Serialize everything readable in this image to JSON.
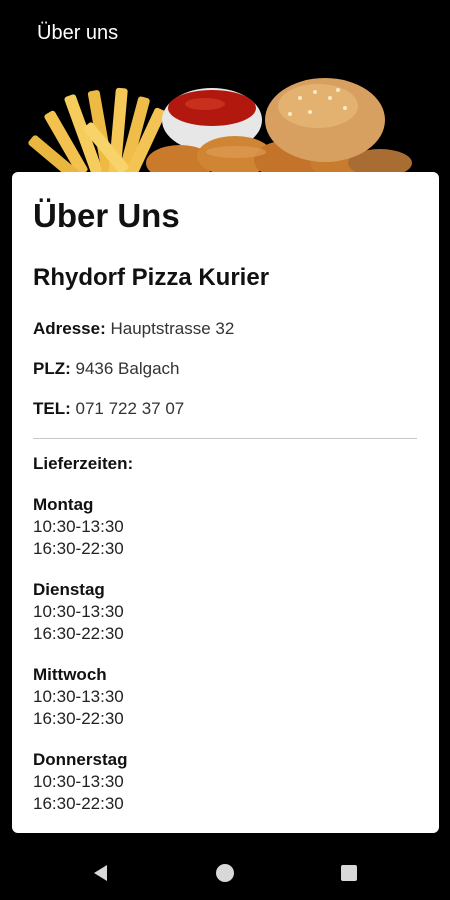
{
  "appbar": {
    "title": "Über uns"
  },
  "about": {
    "heading": "Über Uns",
    "business_name": "Rhydorf Pizza Kurier",
    "address_label": "Adresse:",
    "address_value": "Hauptstrasse 32",
    "plz_label": "PLZ:",
    "plz_value": "9436 Balgach",
    "tel_label": "TEL:",
    "tel_value": "071 722 37 07",
    "delivery_times_label": "Lieferzeiten:",
    "days": [
      {
        "name": "Montag",
        "time1": "10:30-13:30",
        "time2": "16:30-22:30"
      },
      {
        "name": "Dienstag",
        "time1": "10:30-13:30",
        "time2": "16:30-22:30"
      },
      {
        "name": "Mittwoch",
        "time1": "10:30-13:30",
        "time2": "16:30-22:30"
      },
      {
        "name": "Donnerstag",
        "time1": "10:30-13:30",
        "time2": "16:30-22:30"
      }
    ]
  },
  "navigation": {
    "back_icon": "back-triangle-icon",
    "home_icon": "home-circle-icon",
    "recents_icon": "recents-square-icon"
  },
  "colors": {
    "background": "#000000",
    "card": "#ffffff"
  }
}
